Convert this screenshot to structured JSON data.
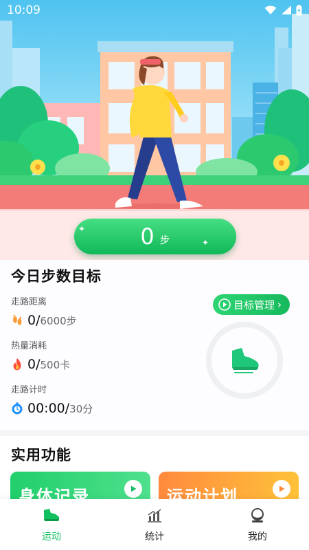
{
  "status_bar": {
    "time": "10:09"
  },
  "hero": {
    "steps": "0",
    "step_unit": "步"
  },
  "goal": {
    "title": "今日步数目标",
    "manage_button": "目标管理",
    "distance": {
      "label": "走路距离",
      "value": "0",
      "goal": "6000步"
    },
    "calories": {
      "label": "热量消耗",
      "value": "0",
      "goal": "500卡"
    },
    "timer": {
      "label": "走路计时",
      "value": "00:00",
      "goal": "30分"
    }
  },
  "functions": {
    "title": "实用功能",
    "cards": [
      {
        "label": "身体记录"
      },
      {
        "label": "运动计划"
      }
    ]
  },
  "nav": {
    "items": [
      {
        "label": "运动",
        "icon": "sneaker-icon"
      },
      {
        "label": "统计",
        "icon": "chart-icon"
      },
      {
        "label": "我的",
        "icon": "profile-icon"
      }
    ],
    "active": "运动"
  },
  "colors": {
    "primary_green": "#13c05f",
    "orange": "#ff8a3d",
    "sky": "#4fc3f0",
    "track": "#f6817c"
  }
}
